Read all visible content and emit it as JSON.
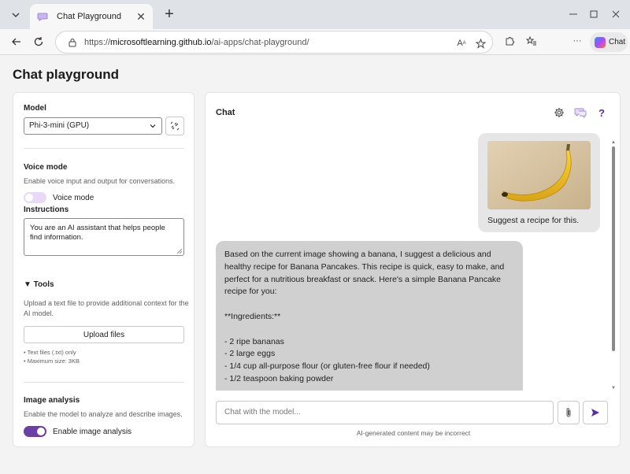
{
  "browser": {
    "tab_title": "Chat Playground",
    "url_prefix": "https://",
    "url_host": "microsoftlearning.github.io",
    "url_path": "/ai-apps/chat-playground/",
    "copilot_label": "Chat"
  },
  "page": {
    "title": "Chat playground"
  },
  "settings": {
    "model_label": "Model",
    "model_selected": "Phi-3-mini (GPU)",
    "voice_heading": "Voice mode",
    "voice_desc": "Enable voice input and output for conversations.",
    "voice_toggle_label": "Voice mode",
    "voice_enabled": false,
    "instructions_label": "Instructions",
    "instructions_value": "You are an AI assistant that helps people find information.",
    "tools_heading": "▼ Tools",
    "tools_desc": "Upload a text file to provide additional context for the AI model.",
    "upload_label": "Upload files",
    "note_1": "• Text files (.txt) only",
    "note_2": "• Maximum size: 3KB",
    "image_heading": "Image analysis",
    "image_desc": "Enable the model to analyze and describe images.",
    "image_toggle_label": "Enable image analysis",
    "image_enabled": true
  },
  "chat": {
    "title": "Chat",
    "user_message": "Suggest a recipe for this.",
    "bot_lines": [
      "Based on the current image showing a banana, I suggest a delicious and healthy recipe for Banana Pancakes. This recipe is quick, easy to make, and perfect for a nutritious breakfast or snack. Here's a simple Banana Pancake recipe for you:",
      "",
      "**Ingredients:**",
      "",
      "- 2 ripe bananas",
      "- 2 large eggs",
      "- 1/4 cup all-purpose flour (or gluten-free flour if needed)",
      "- 1/2 teaspoon baking powder"
    ],
    "input_placeholder": "Chat with the model...",
    "disclaimer": "AI-generated content may be incorrect"
  },
  "colors": {
    "accent": "#6b3fa6",
    "toggle_off": "#e8d9f6",
    "bot_bubble": "#d0d0d0",
    "user_bubble": "#e6e6e6"
  }
}
